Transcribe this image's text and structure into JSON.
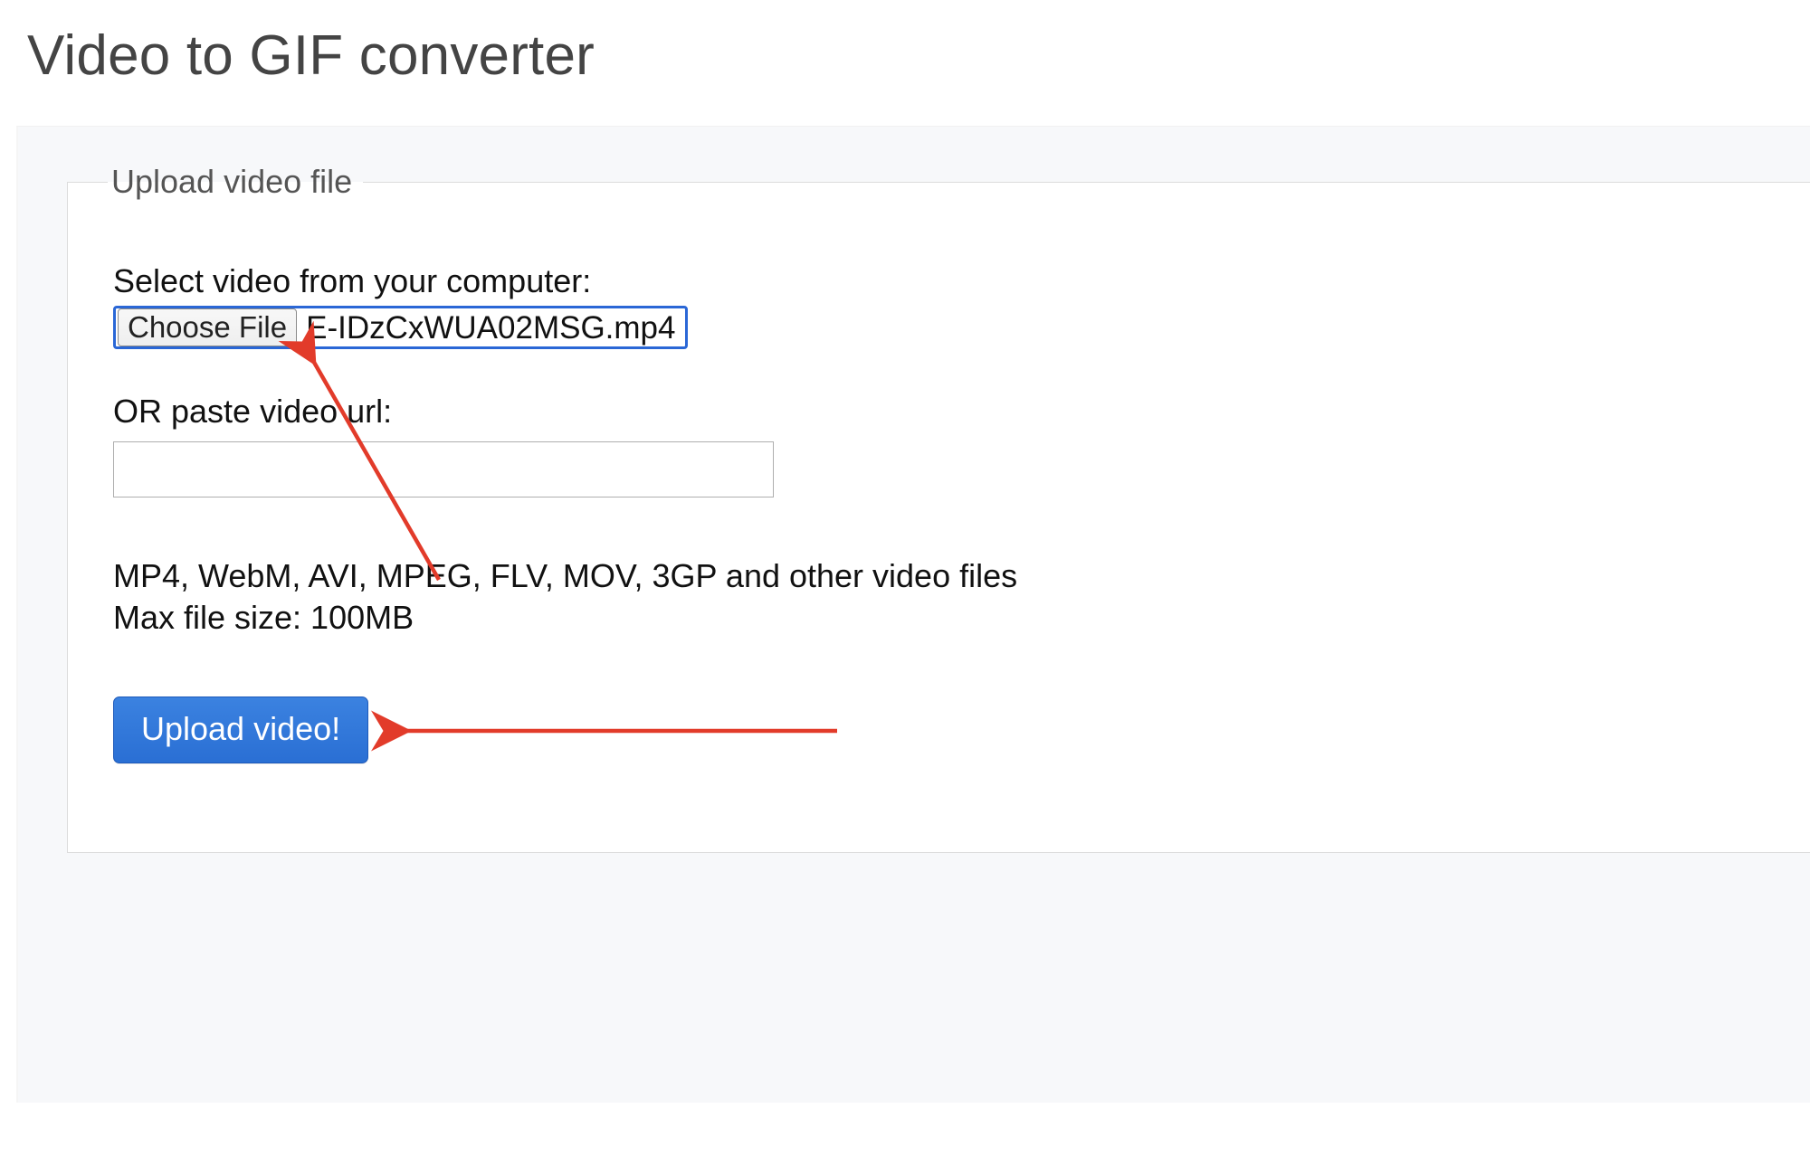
{
  "page": {
    "title": "Video to GIF converter"
  },
  "upload": {
    "legend": "Upload video file",
    "select_label": "Select video from your computer:",
    "choose_file_label": "Choose File",
    "chosen_filename": "E-IDzCxWUA02MSG.mp4",
    "or_label": "OR paste video url:",
    "url_value": "",
    "supported_formats": "MP4, WebM, AVI, MPEG, FLV, MOV, 3GP and other video files",
    "max_size_label": "Max file size: 100MB",
    "upload_button": "Upload video!"
  },
  "annotations": {
    "arrow_color": "#e23b2a"
  }
}
